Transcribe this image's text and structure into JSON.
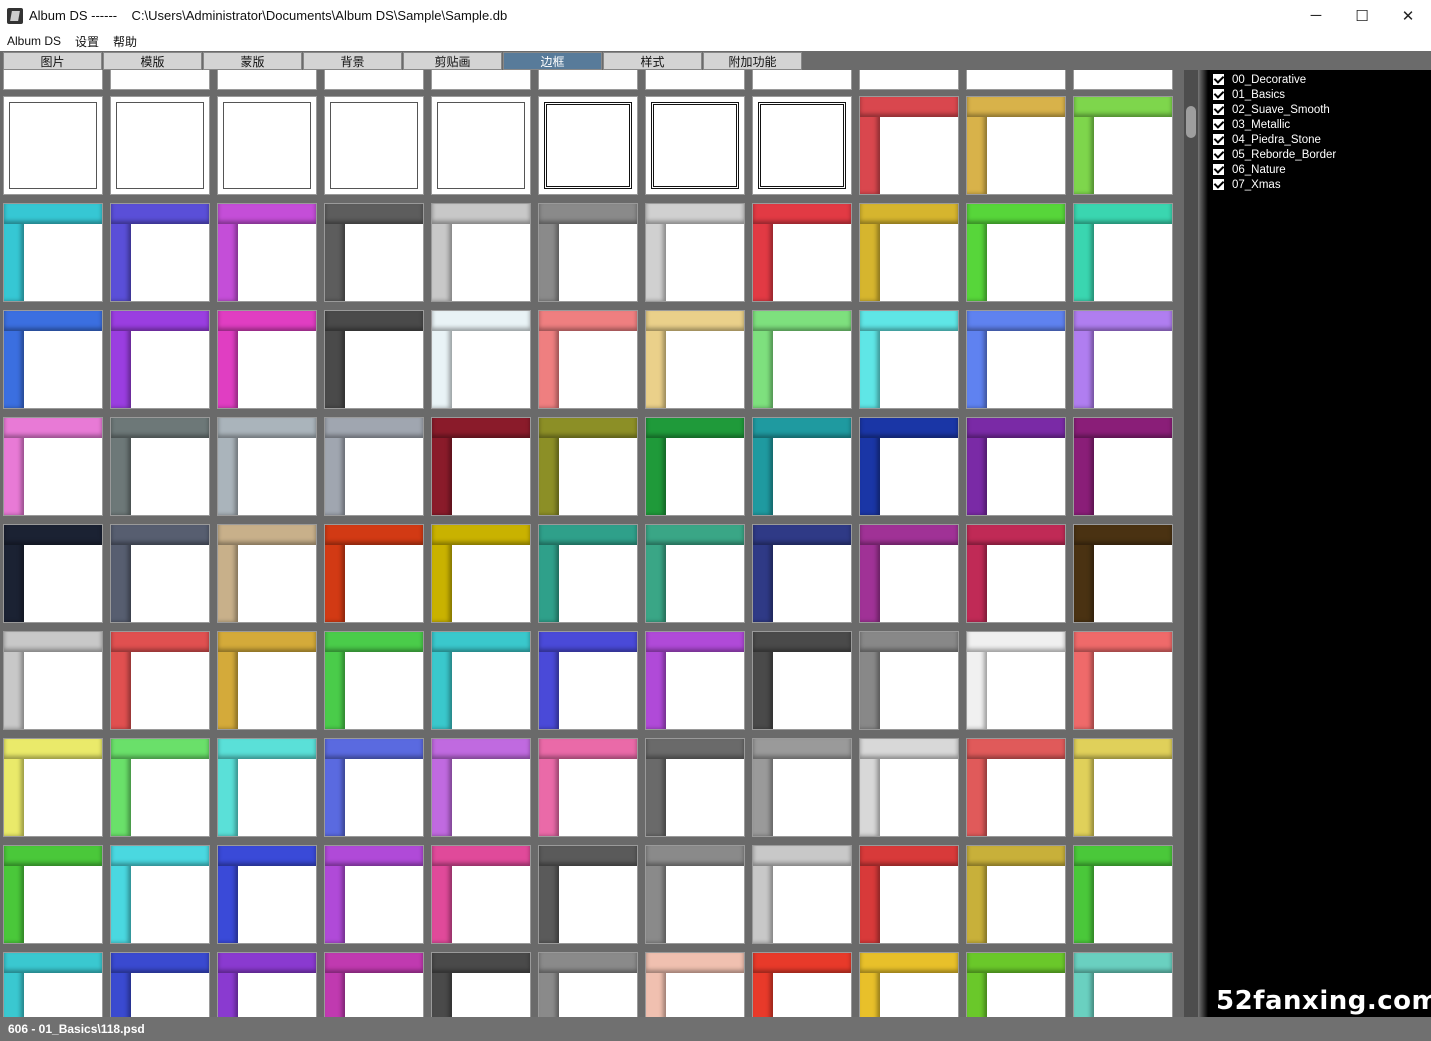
{
  "window": {
    "title": "Album DS ------    C:\\Users\\Administrator\\Documents\\Album DS\\Sample\\Sample.db",
    "minimize": "─",
    "maximize": "☐",
    "close": "✕"
  },
  "menu": [
    "Album DS",
    "设置",
    "帮助"
  ],
  "tabs": [
    {
      "label": "图片"
    },
    {
      "label": "模版"
    },
    {
      "label": "蒙版"
    },
    {
      "label": "背景"
    },
    {
      "label": "剪贴画"
    },
    {
      "label": "边框",
      "active": true
    },
    {
      "label": "样式"
    },
    {
      "label": "附加功能"
    }
  ],
  "categories": [
    "00_Decorative",
    "01_Basics",
    "02_Suave_Smooth",
    "03_Metallic",
    "04_Piedra_Stone",
    "05_Reborde_Border",
    "06_Nature",
    "07_Xmas"
  ],
  "status": "606 - 01_Basics\\118.psd",
  "watermark": "52fanxing.com",
  "frames": [
    [
      "deco",
      "deco",
      "deco",
      "deco",
      "deco",
      "deco",
      "deco",
      "deco",
      "#d9474e",
      "#d8b24a",
      "#7ed64c"
    ],
    [
      "#36c7d4",
      "#5a4fd8",
      "#c44ed8",
      "#5d5d5d",
      "#c8c8c8",
      "#8a8a8a",
      "#d0d0d0",
      "#e23a44",
      "#d6b52e",
      "#57d63a",
      "#3ad6b0"
    ],
    [
      "#3b6fe0",
      "#9a3ee0",
      "#e03ec2",
      "#4a4a4a",
      "#e9f3f6",
      "#ef7f80",
      "#ead08a",
      "#7ee07e",
      "#5fe6e6",
      "#5f82f0",
      "#b07ef0"
    ],
    [
      "#e87ad6",
      "#6d7878",
      "#aab4bb",
      "#a0a6b0",
      "#8a1b2a",
      "#8c8f26",
      "#1f9a3a",
      "#1f9aa0",
      "#1a36a6",
      "#7a2aa6",
      "#8a1e78"
    ],
    [
      "#1b2233",
      "#575e70",
      "#c8b08a",
      "#d23a14",
      "#c9b200",
      "#2fa08a",
      "#3aa686",
      "#2f3a86",
      "#a03296",
      "#c02a56",
      "#4a3212"
    ],
    [
      "#c8c8c8",
      "#e05050",
      "#d4aa3a",
      "#4acc4a",
      "#3ac8cc",
      "#4a4ad8",
      "#b04ad8",
      "#4a4a4a",
      "#888888",
      "#f0f0f0",
      "#ef6a6a"
    ],
    [
      "#eaea6a",
      "#6ae06a",
      "#5ae0d8",
      "#5a6ae0",
      "#c06ae0",
      "#ea6aa8",
      "#6a6a6a",
      "#9a9a9a",
      "#d8d8d8",
      "#e05a5a",
      "#e0d05a"
    ],
    [
      "#4ac83a",
      "#4ad8e0",
      "#3a4ad8",
      "#b04ad8",
      "#e04a9a",
      "#5a5a5a",
      "#8a8a8a",
      "#c8c8c8",
      "#d83a3a",
      "#c8b03a",
      "#4ac83a"
    ],
    [
      "#3ac8d0",
      "#3a4ad0",
      "#8a3ad0",
      "#c03ab0",
      "#4a4a4a",
      "#8a8a8a",
      "#f0c0b0",
      "#e83a2a",
      "#e8c02a",
      "#6ac82a",
      "#6ad0c0"
    ]
  ]
}
